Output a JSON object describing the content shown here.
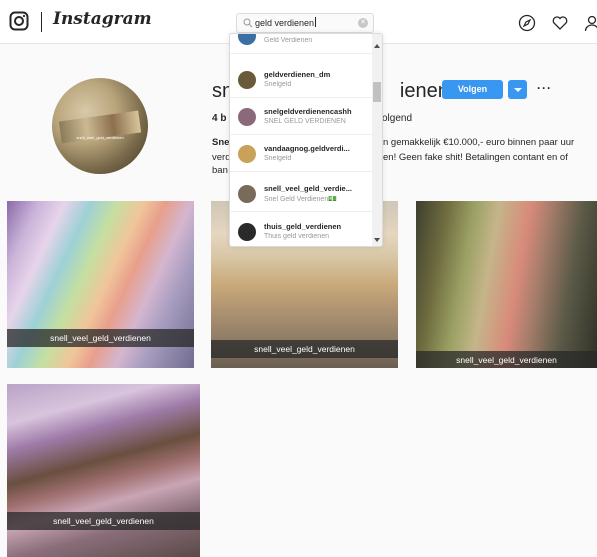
{
  "app": {
    "logo": "Instagram"
  },
  "search": {
    "value": "geld verdienen",
    "clear": "✕"
  },
  "profile": {
    "username_start": "sn",
    "username_end": "ienen",
    "follow_label": "Volgen",
    "more_label": "···",
    "stats_visible": "4 b",
    "following_label": "volgend",
    "avatar_caption": "snell_veel_geld_verdienen",
    "bio_left": [
      "Sne",
      "verd",
      "ban"
    ],
    "bio_right": [
      "n gemakkelijk €10.000,- euro binnen paar uur",
      "en! Geen fake shit! Betalingen contant en of"
    ]
  },
  "posts": [
    {
      "caption": "snell_veel_geld_verdienen"
    },
    {
      "caption": "snell_veel_geld_verdienen"
    },
    {
      "caption": "snell_veel_geld_verdienen"
    },
    {
      "caption": "snell_veel_geld_verdienen"
    }
  ],
  "suggestions": [
    {
      "name": "",
      "sub": "Geld Verdienen",
      "color": "#3a6ea5"
    },
    {
      "name": "geldverdienen_dm",
      "sub": "Snelgeld",
      "color": "#6b5a3a"
    },
    {
      "name": "snelgeldverdienencashh",
      "sub": "SNEL GELD VERDIENEN",
      "color": "#8a6a7a"
    },
    {
      "name": "vandaagnog.geldverdi...",
      "sub": "Snelgeld",
      "color": "#c9a25a"
    },
    {
      "name": "snell_veel_geld_verdie...",
      "sub": "Snel Geld Verdienen💵",
      "color": "#7a6a5a"
    },
    {
      "name": "thuis_geld_verdienen",
      "sub": "Thuis geld verdienen",
      "color": "#2a2a2a"
    }
  ]
}
